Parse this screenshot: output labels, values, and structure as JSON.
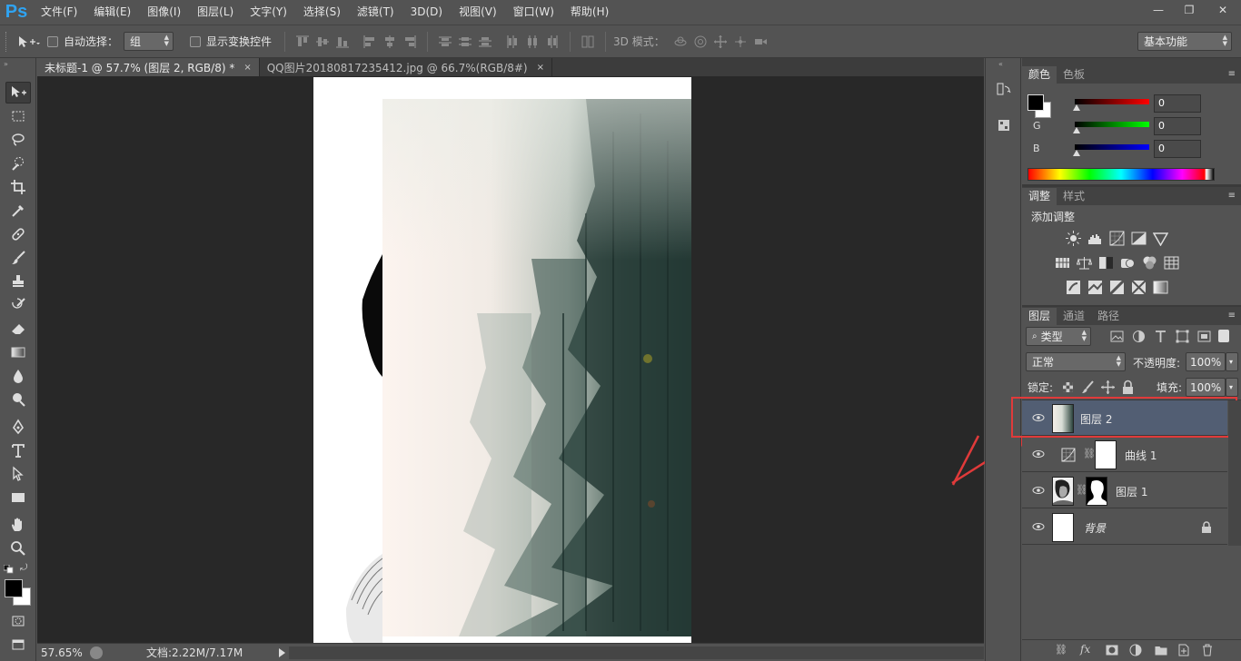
{
  "app": {
    "logo": "Ps"
  },
  "menu": [
    "文件(F)",
    "编辑(E)",
    "图像(I)",
    "图层(L)",
    "文字(Y)",
    "选择(S)",
    "滤镜(T)",
    "3D(D)",
    "视图(V)",
    "窗口(W)",
    "帮助(H)"
  ],
  "window_buttons": {
    "minimize": "—",
    "restore": "❐",
    "close": "✕"
  },
  "options": {
    "auto_select_label": "自动选择：",
    "auto_select_value": "组",
    "show_transform_label": "显示变换控件",
    "mode_3d_label": "3D 模式：",
    "workspace": "基本功能"
  },
  "tabs": [
    {
      "label": "未标题-1 @ 57.7% (图层 2, RGB/8) *",
      "close": "×",
      "active": true
    },
    {
      "label": "QQ图片20180817235412.jpg @ 66.7%(RGB/8#)",
      "close": "×",
      "active": false
    }
  ],
  "status": {
    "zoom": "57.65%",
    "doc_info": "文档:2.22M/7.17M"
  },
  "color_panel": {
    "tabs": [
      "颜色",
      "色板"
    ],
    "channels": [
      {
        "label": "R",
        "value": "0",
        "color": "#e01010"
      },
      {
        "label": "G",
        "value": "0",
        "color": "#10c010"
      },
      {
        "label": "B",
        "value": "0",
        "color": "#1010e0"
      }
    ]
  },
  "adjust_panel": {
    "tabs": [
      "调整",
      "样式"
    ],
    "title": "添加调整",
    "icons": [
      "brightness-icon",
      "levels-icon",
      "curves-icon",
      "exposure-icon",
      "vibrance-icon",
      "hue-saturation-icon",
      "color-balance-icon",
      "black-white-icon",
      "photo-filter-icon",
      "channel-mixer-icon",
      "color-lookup-icon",
      "invert-icon",
      "posterize-icon",
      "threshold-icon",
      "selective-color-icon",
      "gradient-map-icon"
    ]
  },
  "layers_panel": {
    "tabs": [
      "图层",
      "通道",
      "路径"
    ],
    "filter_kind": "类型",
    "blend_mode": "正常",
    "opacity_label": "不透明度:",
    "opacity_value": "100%",
    "lock_label": "锁定:",
    "fill_label": "填充:",
    "fill_value": "100%",
    "layers": [
      {
        "name": "图层 2",
        "selected": true
      },
      {
        "name": "曲线 1",
        "selected": false
      },
      {
        "name": "图层 1",
        "selected": false
      },
      {
        "name": "背景",
        "selected": false
      }
    ]
  },
  "highlight_color": "#e03a3a",
  "selected_layer_color": "#525e73"
}
